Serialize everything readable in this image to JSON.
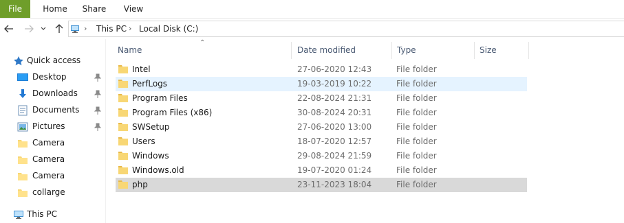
{
  "ribbon": {
    "tabs": [
      {
        "label": "File",
        "active": true
      },
      {
        "label": "Home"
      },
      {
        "label": "Share"
      },
      {
        "label": "View"
      }
    ]
  },
  "address": {
    "crumbs": [
      "This PC",
      "Local Disk (C:)"
    ]
  },
  "nav_pane": {
    "items": [
      {
        "label": "Quick access",
        "icon": "star-icon"
      },
      {
        "label": "Desktop",
        "icon": "desktop-icon",
        "pinned": true
      },
      {
        "label": "Downloads",
        "icon": "download-icon",
        "pinned": true
      },
      {
        "label": "Documents",
        "icon": "documents-icon",
        "pinned": true
      },
      {
        "label": "Pictures",
        "icon": "pictures-icon",
        "pinned": true
      },
      {
        "label": "Camera",
        "icon": "folder-icon"
      },
      {
        "label": "Camera",
        "icon": "folder-icon"
      },
      {
        "label": "Camera",
        "icon": "folder-icon"
      },
      {
        "label": "collarge",
        "icon": "folder-icon"
      },
      {
        "label": "This PC",
        "icon": "computer-icon"
      }
    ]
  },
  "columns": {
    "name": "Name",
    "date": "Date modified",
    "type": "Type",
    "size": "Size",
    "sorted_by": "Name"
  },
  "files": [
    {
      "name": "Intel",
      "date": "27-06-2020 12:43",
      "type": "File folder",
      "size": "",
      "state": ""
    },
    {
      "name": "PerfLogs",
      "date": "19-03-2019 10:22",
      "type": "File folder",
      "size": "",
      "state": "hover"
    },
    {
      "name": "Program Files",
      "date": "22-08-2024 21:31",
      "type": "File folder",
      "size": "",
      "state": ""
    },
    {
      "name": "Program Files (x86)",
      "date": "30-08-2024 20:31",
      "type": "File folder",
      "size": "",
      "state": ""
    },
    {
      "name": "SWSetup",
      "date": "27-06-2020 13:00",
      "type": "File folder",
      "size": "",
      "state": ""
    },
    {
      "name": "Users",
      "date": "18-07-2020 12:57",
      "type": "File folder",
      "size": "",
      "state": ""
    },
    {
      "name": "Windows",
      "date": "29-08-2024 21:59",
      "type": "File folder",
      "size": "",
      "state": ""
    },
    {
      "name": "Windows.old",
      "date": "19-07-2020 01:24",
      "type": "File folder",
      "size": "",
      "state": ""
    },
    {
      "name": "php",
      "date": "23-11-2023 18:04",
      "type": "File folder",
      "size": "",
      "state": "selected"
    }
  ],
  "colors": {
    "file_tab": "#6f9e2a",
    "folder": "#f8d775",
    "hover_row": "#e5f3ff",
    "selected_row": "#d9d9d9",
    "header_text": "#4a5a73"
  }
}
